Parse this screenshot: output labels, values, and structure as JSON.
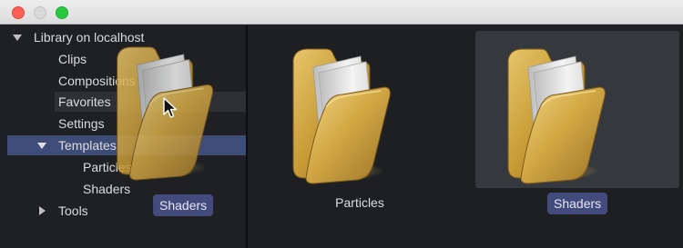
{
  "window": {
    "controls": {
      "close": "close",
      "minimize": "minimize",
      "zoom": "zoom"
    }
  },
  "sidebar": {
    "root_label": "Library on localhost",
    "items": [
      {
        "label": "Clips"
      },
      {
        "label": "Compositions"
      },
      {
        "label": "Favorites"
      },
      {
        "label": "Settings"
      },
      {
        "label": "Templates",
        "expanded": true,
        "selected": true
      },
      {
        "label": "Particles",
        "child_of": "Templates"
      },
      {
        "label": "Shaders",
        "child_of": "Templates"
      },
      {
        "label": "Tools",
        "expanded": false
      }
    ]
  },
  "drag": {
    "label": "Shaders",
    "icon": "folder-icon"
  },
  "main": {
    "tiles": [
      {
        "label": "Particles",
        "icon": "folder-icon",
        "selected": false
      },
      {
        "label": "Shaders",
        "icon": "folder-icon",
        "selected": true
      }
    ]
  },
  "colors": {
    "selection": "#3e4c78",
    "tag_background": "#434a7c",
    "folder_gold": "#c9a040"
  }
}
